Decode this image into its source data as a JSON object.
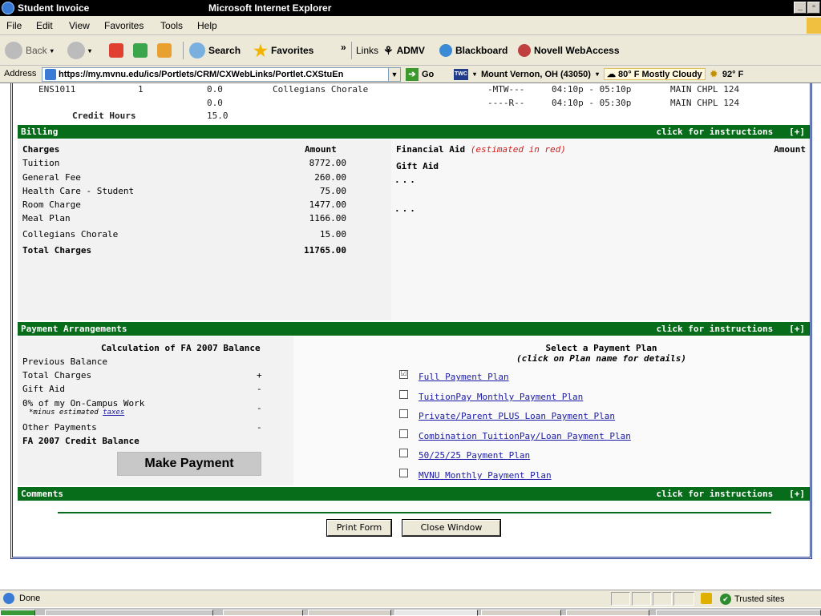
{
  "window": {
    "title_left": "Student Invoice",
    "title_app": "Microsoft Internet Explorer"
  },
  "menu": [
    "File",
    "Edit",
    "View",
    "Favorites",
    "Tools",
    "Help"
  ],
  "toolbar": {
    "back": "Back",
    "search": "Search",
    "favorites": "Favorites",
    "more": "»",
    "links_label": "Links",
    "links": [
      "ADMV",
      "Blackboard",
      "Novell WebAccess"
    ]
  },
  "address": {
    "label": "Address",
    "url": "https://my.mvnu.edu/ics/Portlets/CRM/CXWebLinks/Portlet.CXStuEn",
    "go": "Go",
    "twc": "TWC",
    "location": "Mount Vernon, OH (43050)",
    "current": "80° F Mostly Cloudy",
    "high": "92° F"
  },
  "schedule": {
    "course": "ENS1011",
    "section": "1",
    "hours1": "0.0",
    "title": "Collegians Chorale",
    "days1": "-MTW---",
    "time1": "04:10p - 05:10p",
    "room1": "MAIN CHPL 124",
    "hours2": "0.0",
    "days2": "----R--",
    "time2": "04:10p - 05:30p",
    "room2": "MAIN CHPL 124",
    "credit_label": "Credit Hours",
    "credit_value": "15.0"
  },
  "billing": {
    "header": "Billing",
    "instructions": "click for instructions",
    "expand": "[+]",
    "charges_label": "Charges",
    "amount_label": "Amount",
    "items": [
      {
        "name": "Tuition",
        "amount": "8772.00"
      },
      {
        "name": "General Fee",
        "amount": "260.00"
      },
      {
        "name": "Health Care - Student",
        "amount": "75.00"
      },
      {
        "name": "Room Charge",
        "amount": "1477.00"
      },
      {
        "name": "Meal Plan",
        "amount": "1166.00"
      },
      {
        "name": "Collegians Chorale",
        "amount": "15.00"
      }
    ],
    "total_label": "Total Charges",
    "total_value": "11765.00",
    "fa_label": "Financial Aid",
    "fa_note": "(estimated in red)",
    "fa_amount_label": "Amount",
    "gift_aid": "Gift Aid",
    "ellipsis1": "...",
    "ellipsis2": "..."
  },
  "payment": {
    "header": "Payment Arrangements",
    "instructions": "click for instructions",
    "expand": "[+]",
    "calc_title": "Calculation of FA 2007 Balance",
    "previous_balance": "Previous Balance",
    "total_charges": "Total Charges",
    "total_sign": "+",
    "gift_aid": "Gift Aid",
    "gift_sign": "-",
    "work_label": "0% of my On-Campus Work",
    "work_sub": "*minus estimated",
    "work_sub_link": "taxes",
    "work_sign": "-",
    "other_payments": "Other Payments",
    "other_sign": "-",
    "credit_balance": "FA 2007 Credit Balance",
    "make_payment": "Make Payment",
    "plan_title": "Select a Payment Plan",
    "plan_subtitle": "(click on Plan name for details)",
    "plans": [
      {
        "name": "Full Payment Plan",
        "checked": true
      },
      {
        "name": "TuitionPay Monthly Payment Plan",
        "checked": false
      },
      {
        "name": "Private/Parent PLUS Loan Payment Plan",
        "checked": false
      },
      {
        "name": "Combination TuitionPay/Loan Payment Plan",
        "checked": false
      },
      {
        "name": "50/25/25 Payment Plan",
        "checked": false
      },
      {
        "name": "MVNU Monthly Payment Plan",
        "checked": false
      }
    ]
  },
  "comments": {
    "header": "Comments",
    "instructions": "click for instructions",
    "expand": "[+]"
  },
  "buttons": {
    "print": "Print Form",
    "close": "Close Window"
  },
  "status": {
    "text": "Done",
    "zone": "Trusted sites"
  },
  "colors": {
    "section_green": "#076d1a",
    "frame_blue": "#1b2f8c",
    "link_blue": "#1a1aa6",
    "estimate_red": "#d02020"
  }
}
